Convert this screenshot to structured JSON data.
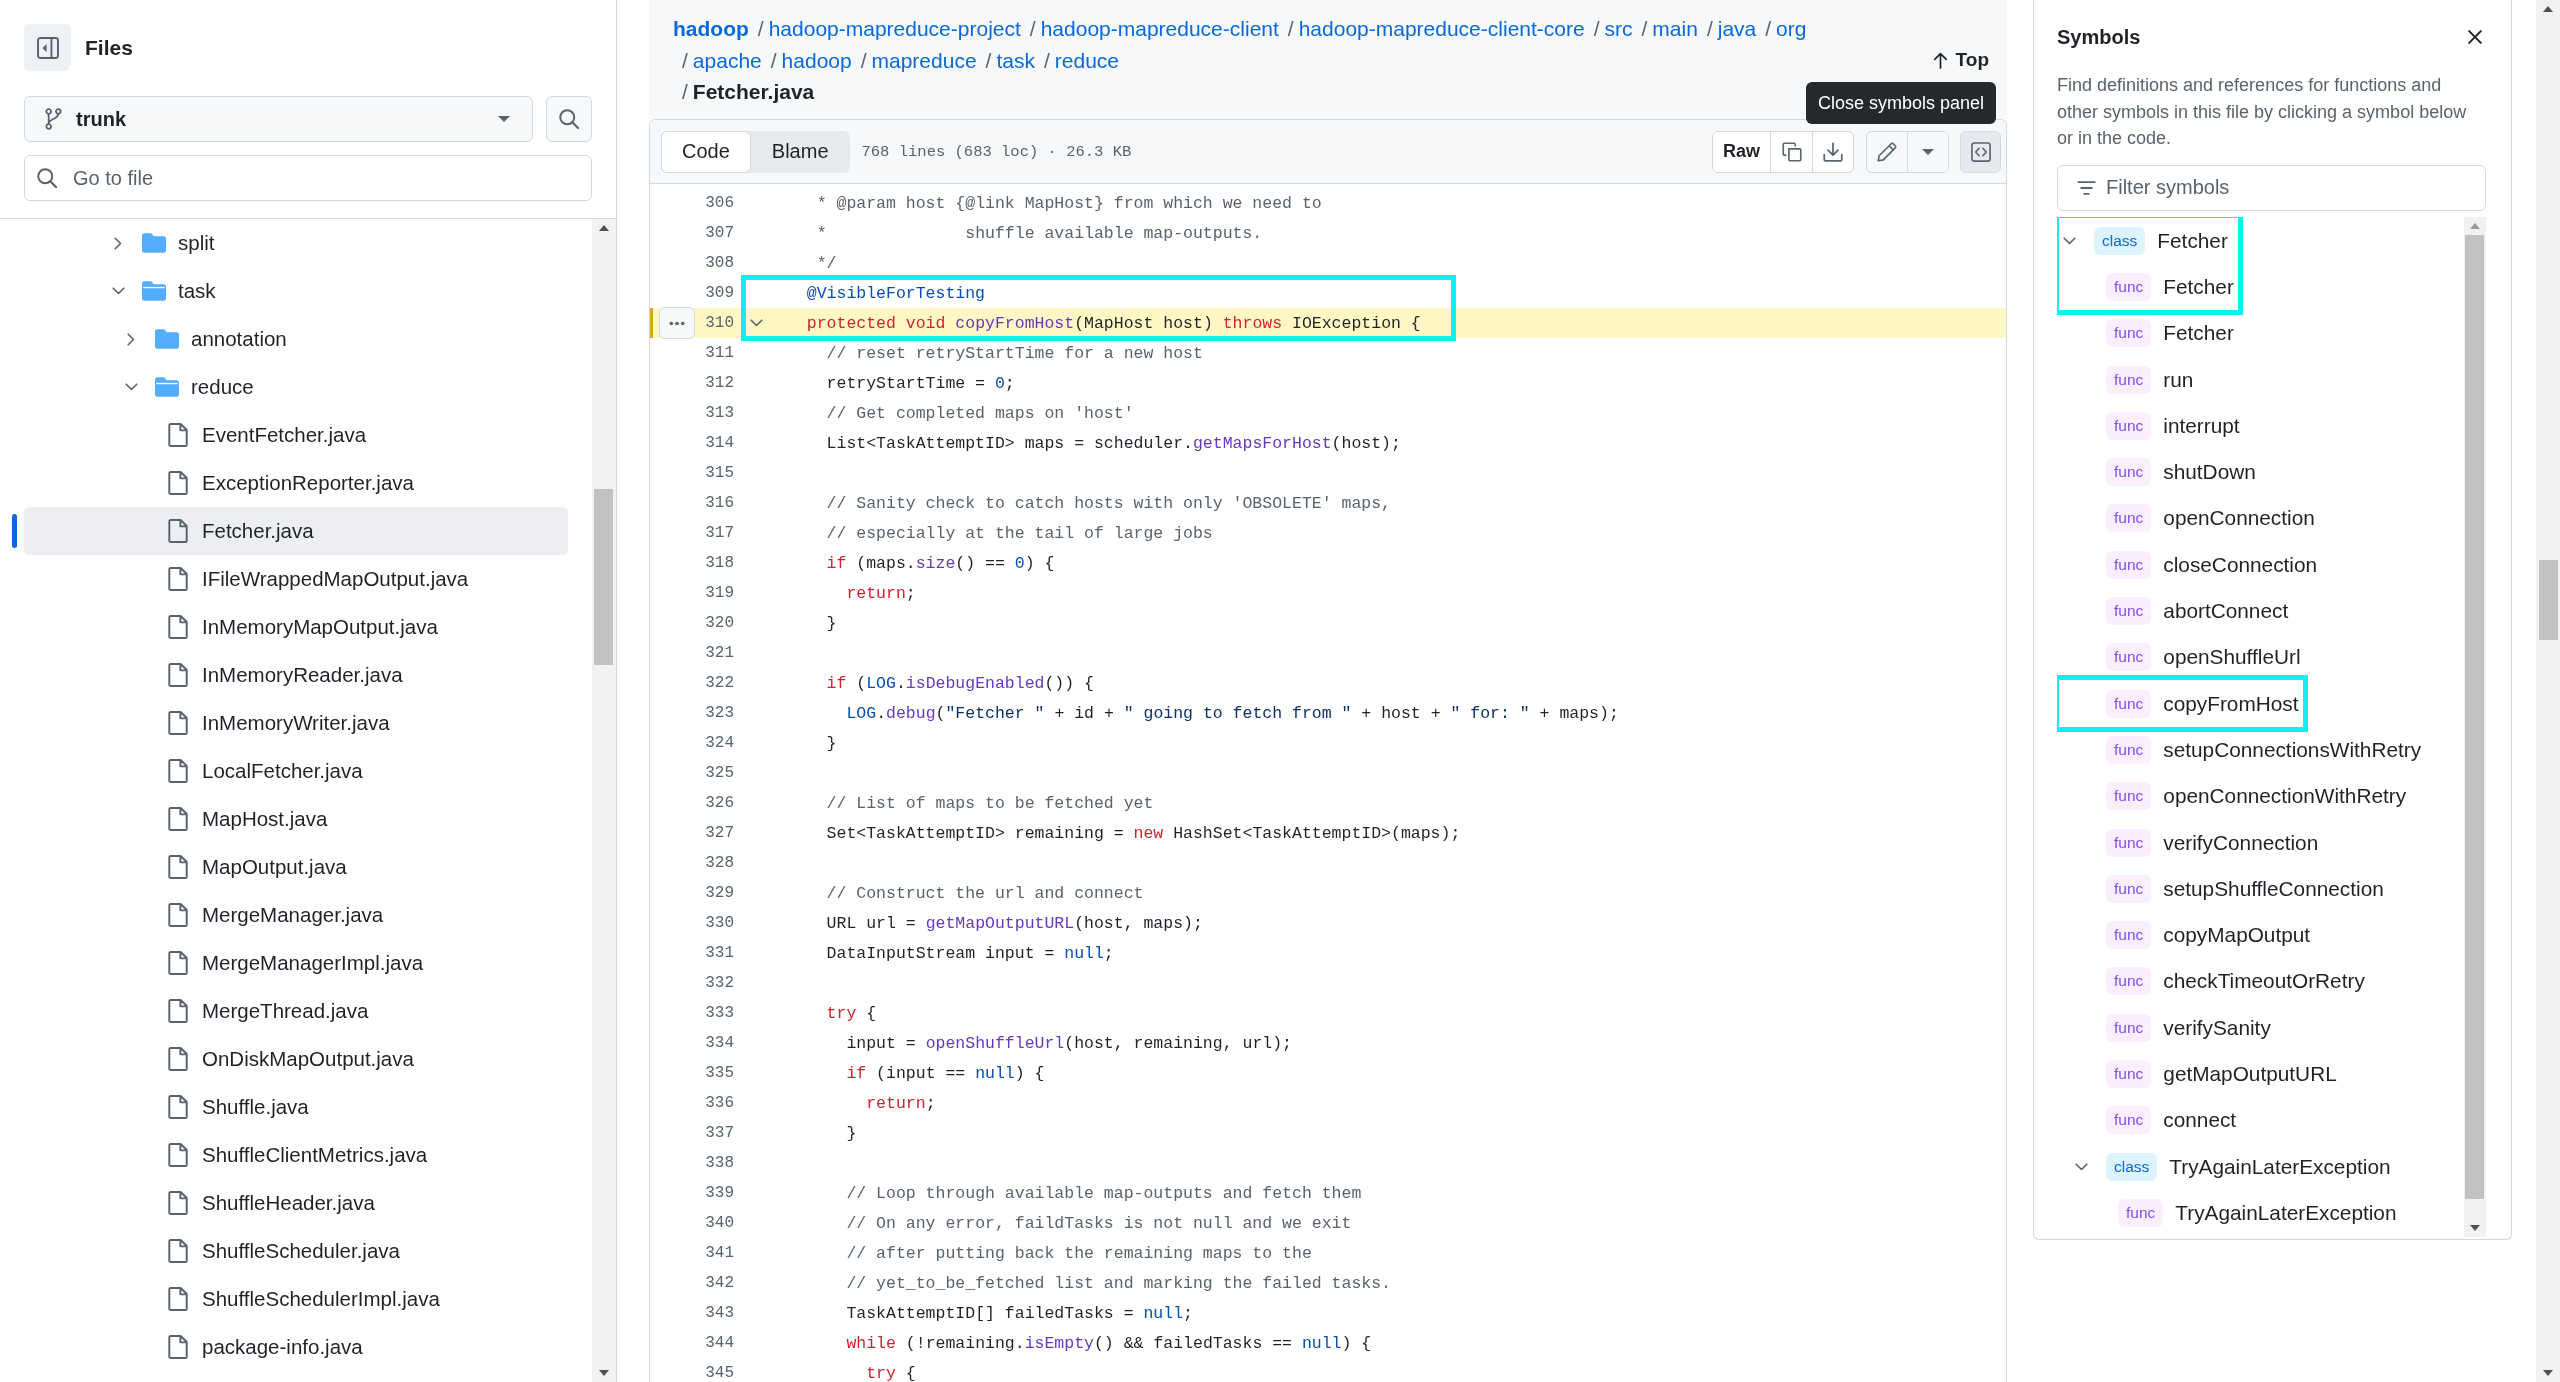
{
  "sidebar": {
    "title": "Files",
    "branch": "trunk",
    "search_placeholder": "Go to file",
    "tree": [
      {
        "kind": "folder",
        "name": "split",
        "expanded": false,
        "selected": false
      },
      {
        "kind": "folder",
        "name": "task",
        "expanded": true,
        "selected": false,
        "children": [
          {
            "kind": "folder",
            "name": "annotation",
            "expanded": false,
            "selected": false
          },
          {
            "kind": "folder",
            "name": "reduce",
            "expanded": true,
            "selected": false,
            "children": [
              {
                "kind": "file",
                "name": "EventFetcher.java",
                "selected": false
              },
              {
                "kind": "file",
                "name": "ExceptionReporter.java",
                "selected": false
              },
              {
                "kind": "file",
                "name": "Fetcher.java",
                "selected": true
              },
              {
                "kind": "file",
                "name": "IFileWrappedMapOutput.java",
                "selected": false
              },
              {
                "kind": "file",
                "name": "InMemoryMapOutput.java",
                "selected": false
              },
              {
                "kind": "file",
                "name": "InMemoryReader.java",
                "selected": false
              },
              {
                "kind": "file",
                "name": "InMemoryWriter.java",
                "selected": false
              },
              {
                "kind": "file",
                "name": "LocalFetcher.java",
                "selected": false
              },
              {
                "kind": "file",
                "name": "MapHost.java",
                "selected": false
              },
              {
                "kind": "file",
                "name": "MapOutput.java",
                "selected": false
              },
              {
                "kind": "file",
                "name": "MergeManager.java",
                "selected": false
              },
              {
                "kind": "file",
                "name": "MergeManagerImpl.java",
                "selected": false
              },
              {
                "kind": "file",
                "name": "MergeThread.java",
                "selected": false
              },
              {
                "kind": "file",
                "name": "OnDiskMapOutput.java",
                "selected": false
              },
              {
                "kind": "file",
                "name": "Shuffle.java",
                "selected": false
              },
              {
                "kind": "file",
                "name": "ShuffleClientMetrics.java",
                "selected": false
              },
              {
                "kind": "file",
                "name": "ShuffleHeader.java",
                "selected": false
              },
              {
                "kind": "file",
                "name": "ShuffleScheduler.java",
                "selected": false
              },
              {
                "kind": "file",
                "name": "ShuffleSchedulerImpl.java",
                "selected": false
              },
              {
                "kind": "file",
                "name": "package-info.java",
                "selected": false
              }
            ]
          }
        ]
      }
    ]
  },
  "header": {
    "breadcrumb": [
      {
        "kind": "repo",
        "text": "hadoop"
      },
      {
        "kind": "dir",
        "separator": "/",
        "text": "hadoop-mapreduce-project"
      },
      {
        "kind": "dir",
        "separator": "/",
        "text": "hadoop-mapreduce-client"
      },
      {
        "kind": "dir",
        "separator": "/",
        "text": "hadoop-mapreduce-client-core"
      },
      {
        "kind": "dir",
        "separator": "/",
        "text": "src"
      },
      {
        "kind": "dir",
        "separator": "/",
        "text": "main"
      },
      {
        "kind": "dir",
        "separator": "/",
        "text": "java"
      },
      {
        "kind": "dir",
        "separator": "/",
        "text": "org"
      },
      {
        "kind": "dir",
        "separator": "/",
        "text": "apache"
      },
      {
        "kind": "dir",
        "separator": "/",
        "text": "hadoop"
      },
      {
        "kind": "dir",
        "separator": "/",
        "text": "mapreduce"
      },
      {
        "kind": "dir",
        "separator": "/",
        "text": "task"
      },
      {
        "kind": "dir",
        "separator": "/",
        "text": "reduce"
      },
      {
        "kind": "file",
        "separator": "/",
        "text": "Fetcher.java"
      }
    ],
    "top_link": "Top"
  },
  "toolbar": {
    "tabs": [
      {
        "label": "Code",
        "selected": true
      },
      {
        "label": "Blame",
        "selected": false
      }
    ],
    "file_info": "768 lines (683 loc) · 26.3 KB",
    "raw_button": "Raw",
    "symbols_toggle": {
      "pressed": true,
      "tooltip": "Close symbols panel"
    }
  },
  "code": {
    "lines": [
      {
        "number": "306",
        "selected": false,
        "outlined": false,
        "tokens": [
          {
            "kind": "comment",
            "text": "   * @param host {@link MapHost} from which we need to"
          }
        ]
      },
      {
        "number": "307",
        "selected": false,
        "outlined": false,
        "tokens": [
          {
            "kind": "comment",
            "text": "   *              shuffle available map-outputs."
          }
        ]
      },
      {
        "number": "308",
        "selected": false,
        "outlined": false,
        "tokens": [
          {
            "kind": "comment",
            "text": "   */"
          }
        ]
      },
      {
        "number": "309",
        "selected": false,
        "outlined": true,
        "tokens": [
          {
            "kind": "annotation",
            "text": "  @VisibleForTesting"
          }
        ]
      },
      {
        "number": "310",
        "selected": true,
        "outlined": true,
        "tokens": [
          {
            "kind": "keyword",
            "text": "  protected void "
          },
          {
            "kind": "function",
            "text": "copyFromHost"
          },
          {
            "kind": "plain",
            "text": "(MapHost host) "
          },
          {
            "kind": "keyword",
            "text": "throws"
          },
          {
            "kind": "plain",
            "text": " IOException {"
          }
        ]
      },
      {
        "number": "311",
        "selected": false,
        "outlined": false,
        "tokens": [
          {
            "kind": "comment",
            "text": "    // reset retryStartTime for a new host"
          }
        ]
      },
      {
        "number": "312",
        "selected": false,
        "outlined": false,
        "tokens": [
          {
            "kind": "plain",
            "text": "    retryStartTime = "
          },
          {
            "kind": "constant",
            "text": "0"
          },
          {
            "kind": "plain",
            "text": ";"
          }
        ]
      },
      {
        "number": "313",
        "selected": false,
        "outlined": false,
        "tokens": [
          {
            "kind": "comment",
            "text": "    // Get completed maps on 'host'"
          }
        ]
      },
      {
        "number": "314",
        "selected": false,
        "outlined": false,
        "tokens": [
          {
            "kind": "plain",
            "text": "    List<TaskAttemptID> maps = scheduler."
          },
          {
            "kind": "function",
            "text": "getMapsForHost"
          },
          {
            "kind": "plain",
            "text": "(host);"
          }
        ]
      },
      {
        "number": "315",
        "selected": false,
        "outlined": false
      },
      {
        "number": "316",
        "selected": false,
        "outlined": false,
        "tokens": [
          {
            "kind": "comment",
            "text": "    // Sanity check to catch hosts with only 'OBSOLETE' maps,"
          }
        ]
      },
      {
        "number": "317",
        "selected": false,
        "outlined": false,
        "tokens": [
          {
            "kind": "comment",
            "text": "    // especially at the tail of large jobs"
          }
        ]
      },
      {
        "number": "318",
        "selected": false,
        "outlined": false,
        "tokens": [
          {
            "kind": "keyword",
            "text": "    if"
          },
          {
            "kind": "plain",
            "text": " (maps."
          },
          {
            "kind": "function",
            "text": "size"
          },
          {
            "kind": "plain",
            "text": "() == "
          },
          {
            "kind": "constant",
            "text": "0"
          },
          {
            "kind": "plain",
            "text": ") {"
          }
        ]
      },
      {
        "number": "319",
        "selected": false,
        "outlined": false,
        "tokens": [
          {
            "kind": "keyword",
            "text": "      return"
          },
          {
            "kind": "plain",
            "text": ";"
          }
        ]
      },
      {
        "number": "320",
        "selected": false,
        "outlined": false,
        "tokens": [
          {
            "kind": "plain",
            "text": "    }"
          }
        ]
      },
      {
        "number": "321",
        "selected": false,
        "outlined": false
      },
      {
        "number": "322",
        "selected": false,
        "outlined": false,
        "tokens": [
          {
            "kind": "keyword",
            "text": "    if"
          },
          {
            "kind": "plain",
            "text": " ("
          },
          {
            "kind": "constant",
            "text": "LOG"
          },
          {
            "kind": "plain",
            "text": "."
          },
          {
            "kind": "function",
            "text": "isDebugEnabled"
          },
          {
            "kind": "plain",
            "text": "()) {"
          }
        ]
      },
      {
        "number": "323",
        "selected": false,
        "outlined": false,
        "tokens": [
          {
            "kind": "constant",
            "text": "      LOG"
          },
          {
            "kind": "plain",
            "text": "."
          },
          {
            "kind": "function",
            "text": "debug"
          },
          {
            "kind": "plain",
            "text": "("
          },
          {
            "kind": "string",
            "text": "\"Fetcher \""
          },
          {
            "kind": "plain",
            "text": " + id + "
          },
          {
            "kind": "string",
            "text": "\" going to fetch from \""
          },
          {
            "kind": "plain",
            "text": " + host + "
          },
          {
            "kind": "string",
            "text": "\" for: \""
          },
          {
            "kind": "plain",
            "text": " + maps);"
          }
        ]
      },
      {
        "number": "324",
        "selected": false,
        "outlined": false,
        "tokens": [
          {
            "kind": "plain",
            "text": "    }"
          }
        ]
      },
      {
        "number": "325",
        "selected": false,
        "outlined": false
      },
      {
        "number": "326",
        "selected": false,
        "outlined": false,
        "tokens": [
          {
            "kind": "comment",
            "text": "    // List of maps to be fetched yet"
          }
        ]
      },
      {
        "number": "327",
        "selected": false,
        "outlined": false,
        "tokens": [
          {
            "kind": "plain",
            "text": "    Set<TaskAttemptID> remaining = "
          },
          {
            "kind": "keyword",
            "text": "new"
          },
          {
            "kind": "plain",
            "text": " HashSet<TaskAttemptID>(maps);"
          }
        ]
      },
      {
        "number": "328",
        "selected": false,
        "outlined": false
      },
      {
        "number": "329",
        "selected": false,
        "outlined": false,
        "tokens": [
          {
            "kind": "comment",
            "text": "    // Construct the url and connect"
          }
        ]
      },
      {
        "number": "330",
        "selected": false,
        "outlined": false,
        "tokens": [
          {
            "kind": "plain",
            "text": "    URL url = "
          },
          {
            "kind": "function",
            "text": "getMapOutputURL"
          },
          {
            "kind": "plain",
            "text": "(host, maps);"
          }
        ]
      },
      {
        "number": "331",
        "selected": false,
        "outlined": false,
        "tokens": [
          {
            "kind": "plain",
            "text": "    DataInputStream input = "
          },
          {
            "kind": "constant",
            "text": "null"
          },
          {
            "kind": "plain",
            "text": ";"
          }
        ]
      },
      {
        "number": "332",
        "selected": false,
        "outlined": false
      },
      {
        "number": "333",
        "selected": false,
        "outlined": false,
        "tokens": [
          {
            "kind": "keyword",
            "text": "    try"
          },
          {
            "kind": "plain",
            "text": " {"
          }
        ]
      },
      {
        "number": "334",
        "selected": false,
        "outlined": false,
        "tokens": [
          {
            "kind": "plain",
            "text": "      input = "
          },
          {
            "kind": "function",
            "text": "openShuffleUrl"
          },
          {
            "kind": "plain",
            "text": "(host, remaining, url);"
          }
        ]
      },
      {
        "number": "335",
        "selected": false,
        "outlined": false,
        "tokens": [
          {
            "kind": "keyword",
            "text": "      if"
          },
          {
            "kind": "plain",
            "text": " (input == "
          },
          {
            "kind": "constant",
            "text": "null"
          },
          {
            "kind": "plain",
            "text": ") {"
          }
        ]
      },
      {
        "number": "336",
        "selected": false,
        "outlined": false,
        "tokens": [
          {
            "kind": "keyword",
            "text": "        return"
          },
          {
            "kind": "plain",
            "text": ";"
          }
        ]
      },
      {
        "number": "337",
        "selected": false,
        "outlined": false,
        "tokens": [
          {
            "kind": "plain",
            "text": "      }"
          }
        ]
      },
      {
        "number": "338",
        "selected": false,
        "outlined": false
      },
      {
        "number": "339",
        "selected": false,
        "outlined": false,
        "tokens": [
          {
            "kind": "comment",
            "text": "      // Loop through available map-outputs and fetch them"
          }
        ]
      },
      {
        "number": "340",
        "selected": false,
        "outlined": false,
        "tokens": [
          {
            "kind": "comment",
            "text": "      // On any error, faildTasks is not null and we exit"
          }
        ]
      },
      {
        "number": "341",
        "selected": false,
        "outlined": false,
        "tokens": [
          {
            "kind": "comment",
            "text": "      // after putting back the remaining maps to the"
          }
        ]
      },
      {
        "number": "342",
        "selected": false,
        "outlined": false,
        "tokens": [
          {
            "kind": "comment",
            "text": "      // yet_to_be_fetched list and marking the failed tasks."
          }
        ]
      },
      {
        "number": "343",
        "selected": false,
        "outlined": false,
        "tokens": [
          {
            "kind": "plain",
            "text": "      TaskAttemptID[] failedTasks = "
          },
          {
            "kind": "constant",
            "text": "null"
          },
          {
            "kind": "plain",
            "text": ";"
          }
        ]
      },
      {
        "number": "344",
        "selected": false,
        "outlined": false,
        "tokens": [
          {
            "kind": "keyword",
            "text": "      while"
          },
          {
            "kind": "plain",
            "text": " (!remaining."
          },
          {
            "kind": "function",
            "text": "isEmpty"
          },
          {
            "kind": "plain",
            "text": "() && failedTasks == "
          },
          {
            "kind": "constant",
            "text": "null"
          },
          {
            "kind": "plain",
            "text": ") {"
          }
        ]
      },
      {
        "number": "345",
        "selected": false,
        "outlined": false,
        "tokens": [
          {
            "kind": "keyword",
            "text": "        try"
          },
          {
            "kind": "plain",
            "text": " {"
          }
        ]
      }
    ]
  },
  "symbols": {
    "title": "Symbols",
    "description": "Find definitions and references for functions and other symbols in this file by clicking a symbol below or in the code.",
    "filter_placeholder": "Filter symbols",
    "items": [
      {
        "kind": "class",
        "badge": "class",
        "name": "Fetcher",
        "expanded": true,
        "outlined": true,
        "children": [
          {
            "kind": "func",
            "badge": "func",
            "name": "Fetcher",
            "outlined": true
          },
          {
            "kind": "func",
            "badge": "func",
            "name": "Fetcher",
            "outlined": false
          },
          {
            "kind": "func",
            "badge": "func",
            "name": "run",
            "outlined": false
          },
          {
            "kind": "func",
            "badge": "func",
            "name": "interrupt",
            "outlined": false
          },
          {
            "kind": "func",
            "badge": "func",
            "name": "shutDown",
            "outlined": false
          },
          {
            "kind": "func",
            "badge": "func",
            "name": "openConnection",
            "outlined": false
          },
          {
            "kind": "func",
            "badge": "func",
            "name": "closeConnection",
            "outlined": false
          },
          {
            "kind": "func",
            "badge": "func",
            "name": "abortConnect",
            "outlined": false
          },
          {
            "kind": "func",
            "badge": "func",
            "name": "openShuffleUrl",
            "outlined": false
          },
          {
            "kind": "func",
            "badge": "func",
            "name": "copyFromHost",
            "outlined": true
          },
          {
            "kind": "func",
            "badge": "func",
            "name": "setupConnectionsWithRetry",
            "outlined": false
          },
          {
            "kind": "func",
            "badge": "func",
            "name": "openConnectionWithRetry",
            "outlined": false
          },
          {
            "kind": "func",
            "badge": "func",
            "name": "verifyConnection",
            "outlined": false
          },
          {
            "kind": "func",
            "badge": "func",
            "name": "setupShuffleConnection",
            "outlined": false
          },
          {
            "kind": "func",
            "badge": "func",
            "name": "copyMapOutput",
            "outlined": false
          },
          {
            "kind": "func",
            "badge": "func",
            "name": "checkTimeoutOrRetry",
            "outlined": false
          },
          {
            "kind": "func",
            "badge": "func",
            "name": "verifySanity",
            "outlined": false
          },
          {
            "kind": "func",
            "badge": "func",
            "name": "getMapOutputURL",
            "outlined": false
          },
          {
            "kind": "func",
            "badge": "func",
            "name": "connect",
            "outlined": false
          },
          {
            "kind": "class",
            "badge": "class",
            "name": "TryAgainLaterException",
            "expanded": true,
            "outlined": false,
            "children": [
              {
                "kind": "func",
                "badge": "func",
                "name": "TryAgainLaterException",
                "outlined": false
              }
            ]
          }
        ]
      }
    ]
  }
}
